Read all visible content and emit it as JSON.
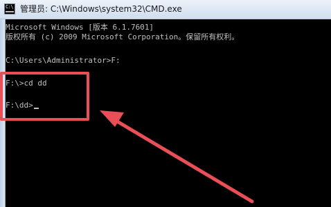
{
  "window": {
    "title": "管理员: C:\\Windows\\system32\\CMD.exe",
    "icon": "cmd-icon",
    "icon_text": "C:\\"
  },
  "console": {
    "lines": [
      "Microsoft Windows [版本 6.1.7601]",
      "版权所有 (c) 2009 Microsoft Corporation。保留所有权利。",
      "C:\\Users\\Administrator>F:",
      "F:\\>cd dd",
      "F:\\dd>"
    ]
  },
  "annotation": {
    "highlight_color": "#ea4e57",
    "arrow_color": "#ea4e57"
  }
}
